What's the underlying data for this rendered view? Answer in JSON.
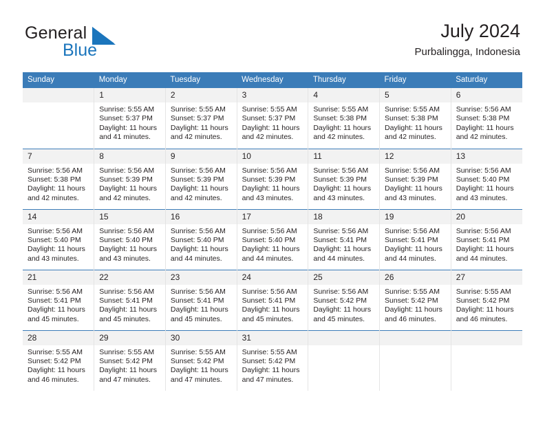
{
  "brand": {
    "name_part1": "General",
    "name_part2": "Blue",
    "mark_icon": "blue-triangle-logo-icon",
    "accent_color": "#1b75bc"
  },
  "header": {
    "title": "July 2024",
    "location": "Purbalingga, Indonesia"
  },
  "theme": {
    "header_blue": "#3b7cb8",
    "daynum_band": "#f2f2f2",
    "cell_divider": "#e4e4e4",
    "text": "#231f20"
  },
  "calendar": {
    "weekday_headers": [
      "Sunday",
      "Monday",
      "Tuesday",
      "Wednesday",
      "Thursday",
      "Friday",
      "Saturday"
    ],
    "weeks": [
      [
        {
          "day": "",
          "sunrise": "",
          "sunset": "",
          "daylight_line1": "",
          "daylight_line2": "",
          "empty": true
        },
        {
          "day": "1",
          "sunrise": "Sunrise: 5:55 AM",
          "sunset": "Sunset: 5:37 PM",
          "daylight_line1": "Daylight: 11 hours",
          "daylight_line2": "and 41 minutes."
        },
        {
          "day": "2",
          "sunrise": "Sunrise: 5:55 AM",
          "sunset": "Sunset: 5:37 PM",
          "daylight_line1": "Daylight: 11 hours",
          "daylight_line2": "and 42 minutes."
        },
        {
          "day": "3",
          "sunrise": "Sunrise: 5:55 AM",
          "sunset": "Sunset: 5:37 PM",
          "daylight_line1": "Daylight: 11 hours",
          "daylight_line2": "and 42 minutes."
        },
        {
          "day": "4",
          "sunrise": "Sunrise: 5:55 AM",
          "sunset": "Sunset: 5:38 PM",
          "daylight_line1": "Daylight: 11 hours",
          "daylight_line2": "and 42 minutes."
        },
        {
          "day": "5",
          "sunrise": "Sunrise: 5:55 AM",
          "sunset": "Sunset: 5:38 PM",
          "daylight_line1": "Daylight: 11 hours",
          "daylight_line2": "and 42 minutes."
        },
        {
          "day": "6",
          "sunrise": "Sunrise: 5:56 AM",
          "sunset": "Sunset: 5:38 PM",
          "daylight_line1": "Daylight: 11 hours",
          "daylight_line2": "and 42 minutes."
        }
      ],
      [
        {
          "day": "7",
          "sunrise": "Sunrise: 5:56 AM",
          "sunset": "Sunset: 5:38 PM",
          "daylight_line1": "Daylight: 11 hours",
          "daylight_line2": "and 42 minutes."
        },
        {
          "day": "8",
          "sunrise": "Sunrise: 5:56 AM",
          "sunset": "Sunset: 5:39 PM",
          "daylight_line1": "Daylight: 11 hours",
          "daylight_line2": "and 42 minutes."
        },
        {
          "day": "9",
          "sunrise": "Sunrise: 5:56 AM",
          "sunset": "Sunset: 5:39 PM",
          "daylight_line1": "Daylight: 11 hours",
          "daylight_line2": "and 42 minutes."
        },
        {
          "day": "10",
          "sunrise": "Sunrise: 5:56 AM",
          "sunset": "Sunset: 5:39 PM",
          "daylight_line1": "Daylight: 11 hours",
          "daylight_line2": "and 43 minutes."
        },
        {
          "day": "11",
          "sunrise": "Sunrise: 5:56 AM",
          "sunset": "Sunset: 5:39 PM",
          "daylight_line1": "Daylight: 11 hours",
          "daylight_line2": "and 43 minutes."
        },
        {
          "day": "12",
          "sunrise": "Sunrise: 5:56 AM",
          "sunset": "Sunset: 5:39 PM",
          "daylight_line1": "Daylight: 11 hours",
          "daylight_line2": "and 43 minutes."
        },
        {
          "day": "13",
          "sunrise": "Sunrise: 5:56 AM",
          "sunset": "Sunset: 5:40 PM",
          "daylight_line1": "Daylight: 11 hours",
          "daylight_line2": "and 43 minutes."
        }
      ],
      [
        {
          "day": "14",
          "sunrise": "Sunrise: 5:56 AM",
          "sunset": "Sunset: 5:40 PM",
          "daylight_line1": "Daylight: 11 hours",
          "daylight_line2": "and 43 minutes."
        },
        {
          "day": "15",
          "sunrise": "Sunrise: 5:56 AM",
          "sunset": "Sunset: 5:40 PM",
          "daylight_line1": "Daylight: 11 hours",
          "daylight_line2": "and 43 minutes."
        },
        {
          "day": "16",
          "sunrise": "Sunrise: 5:56 AM",
          "sunset": "Sunset: 5:40 PM",
          "daylight_line1": "Daylight: 11 hours",
          "daylight_line2": "and 44 minutes."
        },
        {
          "day": "17",
          "sunrise": "Sunrise: 5:56 AM",
          "sunset": "Sunset: 5:40 PM",
          "daylight_line1": "Daylight: 11 hours",
          "daylight_line2": "and 44 minutes."
        },
        {
          "day": "18",
          "sunrise": "Sunrise: 5:56 AM",
          "sunset": "Sunset: 5:41 PM",
          "daylight_line1": "Daylight: 11 hours",
          "daylight_line2": "and 44 minutes."
        },
        {
          "day": "19",
          "sunrise": "Sunrise: 5:56 AM",
          "sunset": "Sunset: 5:41 PM",
          "daylight_line1": "Daylight: 11 hours",
          "daylight_line2": "and 44 minutes."
        },
        {
          "day": "20",
          "sunrise": "Sunrise: 5:56 AM",
          "sunset": "Sunset: 5:41 PM",
          "daylight_line1": "Daylight: 11 hours",
          "daylight_line2": "and 44 minutes."
        }
      ],
      [
        {
          "day": "21",
          "sunrise": "Sunrise: 5:56 AM",
          "sunset": "Sunset: 5:41 PM",
          "daylight_line1": "Daylight: 11 hours",
          "daylight_line2": "and 45 minutes."
        },
        {
          "day": "22",
          "sunrise": "Sunrise: 5:56 AM",
          "sunset": "Sunset: 5:41 PM",
          "daylight_line1": "Daylight: 11 hours",
          "daylight_line2": "and 45 minutes."
        },
        {
          "day": "23",
          "sunrise": "Sunrise: 5:56 AM",
          "sunset": "Sunset: 5:41 PM",
          "daylight_line1": "Daylight: 11 hours",
          "daylight_line2": "and 45 minutes."
        },
        {
          "day": "24",
          "sunrise": "Sunrise: 5:56 AM",
          "sunset": "Sunset: 5:41 PM",
          "daylight_line1": "Daylight: 11 hours",
          "daylight_line2": "and 45 minutes."
        },
        {
          "day": "25",
          "sunrise": "Sunrise: 5:56 AM",
          "sunset": "Sunset: 5:42 PM",
          "daylight_line1": "Daylight: 11 hours",
          "daylight_line2": "and 45 minutes."
        },
        {
          "day": "26",
          "sunrise": "Sunrise: 5:55 AM",
          "sunset": "Sunset: 5:42 PM",
          "daylight_line1": "Daylight: 11 hours",
          "daylight_line2": "and 46 minutes."
        },
        {
          "day": "27",
          "sunrise": "Sunrise: 5:55 AM",
          "sunset": "Sunset: 5:42 PM",
          "daylight_line1": "Daylight: 11 hours",
          "daylight_line2": "and 46 minutes."
        }
      ],
      [
        {
          "day": "28",
          "sunrise": "Sunrise: 5:55 AM",
          "sunset": "Sunset: 5:42 PM",
          "daylight_line1": "Daylight: 11 hours",
          "daylight_line2": "and 46 minutes."
        },
        {
          "day": "29",
          "sunrise": "Sunrise: 5:55 AM",
          "sunset": "Sunset: 5:42 PM",
          "daylight_line1": "Daylight: 11 hours",
          "daylight_line2": "and 47 minutes."
        },
        {
          "day": "30",
          "sunrise": "Sunrise: 5:55 AM",
          "sunset": "Sunset: 5:42 PM",
          "daylight_line1": "Daylight: 11 hours",
          "daylight_line2": "and 47 minutes."
        },
        {
          "day": "31",
          "sunrise": "Sunrise: 5:55 AM",
          "sunset": "Sunset: 5:42 PM",
          "daylight_line1": "Daylight: 11 hours",
          "daylight_line2": "and 47 minutes."
        },
        {
          "day": "",
          "sunrise": "",
          "sunset": "",
          "daylight_line1": "",
          "daylight_line2": "",
          "empty": true
        },
        {
          "day": "",
          "sunrise": "",
          "sunset": "",
          "daylight_line1": "",
          "daylight_line2": "",
          "empty": true
        },
        {
          "day": "",
          "sunrise": "",
          "sunset": "",
          "daylight_line1": "",
          "daylight_line2": "",
          "empty": true
        }
      ]
    ]
  }
}
